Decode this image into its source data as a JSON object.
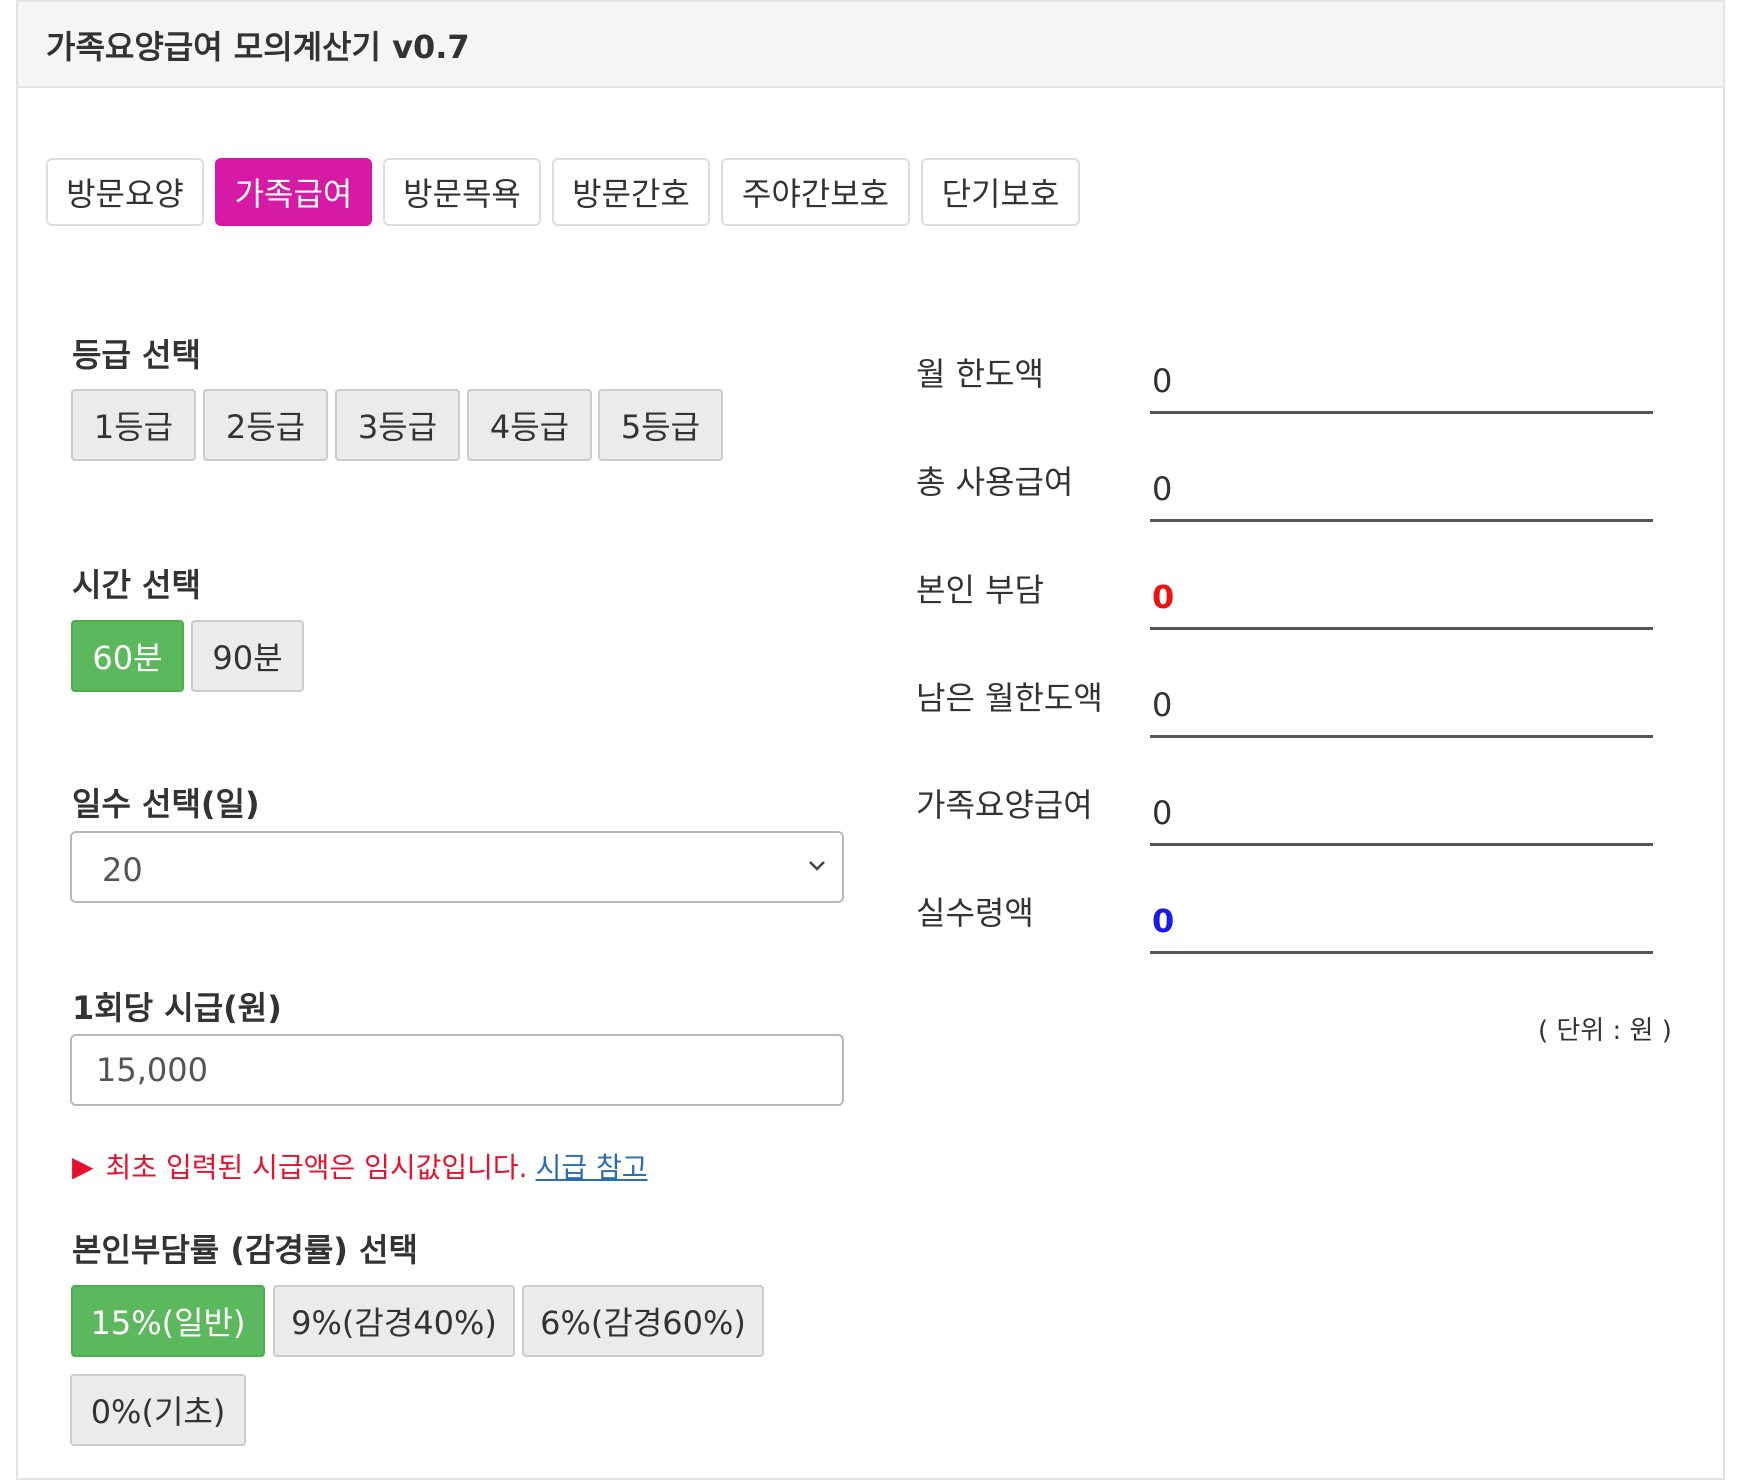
{
  "header": {
    "title": "가족요양급여 모의계산기 v0.7"
  },
  "tabs": [
    {
      "label": "방문요양",
      "active": false
    },
    {
      "label": "가족급여",
      "active": true
    },
    {
      "label": "방문목욕",
      "active": false
    },
    {
      "label": "방문간호",
      "active": false
    },
    {
      "label": "주야간보호",
      "active": false
    },
    {
      "label": "단기보호",
      "active": false
    }
  ],
  "grade": {
    "label": "등급 선택",
    "options": [
      "1등급",
      "2등급",
      "3등급",
      "4등급",
      "5등급"
    ],
    "selected": null
  },
  "time": {
    "label": "시간 선택",
    "options": [
      "60분",
      "90분"
    ],
    "selected": "60분"
  },
  "days": {
    "label": "일수 선택(일)",
    "value": "20"
  },
  "wage": {
    "label": "1회당 시급(원)",
    "value": "15,000"
  },
  "notice": {
    "arrow": "▶",
    "text": "최초 입력된 시급액은 임시값입니다.",
    "link": "시급 참고"
  },
  "copay": {
    "label": "본인부담률 (감경률) 선택",
    "options": [
      "15%(일반)",
      "9%(감경40%)",
      "6%(감경60%)",
      "0%(기초)"
    ],
    "selected": "15%(일반)"
  },
  "results": [
    {
      "label": "월 한도액",
      "value": "0",
      "style": "normal"
    },
    {
      "label": "총 사용급여",
      "value": "0",
      "style": "normal"
    },
    {
      "label": "본인 부담",
      "value": "0",
      "style": "red"
    },
    {
      "label": "남은 월한도액",
      "value": "0",
      "style": "normal"
    },
    {
      "label": "가족요양급여",
      "value": "0",
      "style": "normal"
    },
    {
      "label": "실수령액",
      "value": "0",
      "style": "blue"
    }
  ],
  "unit_note": "( 단위 : 원 )",
  "colors": {
    "tab_active": "#d61aa6",
    "button_active": "#5cb85c",
    "copay_value": "#ee1111",
    "net_value": "#1a1aee",
    "notice_text": "#e8112d",
    "link": "#2a6db5"
  }
}
